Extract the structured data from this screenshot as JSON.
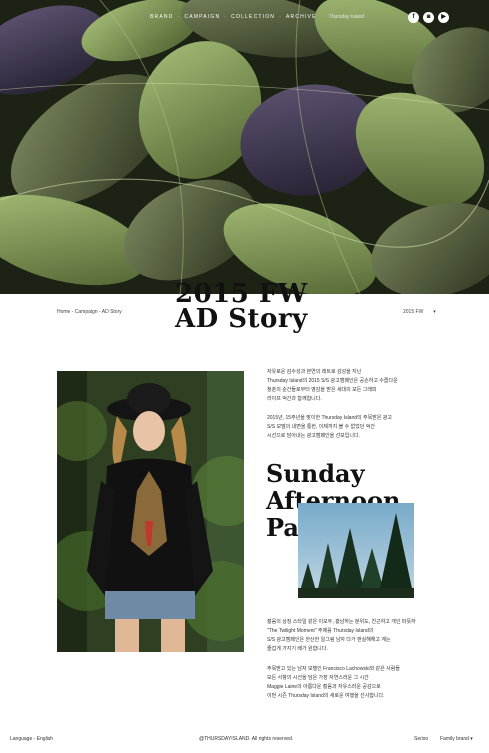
{
  "nav": {
    "items": [
      "BRAND",
      "CAMPAIGN",
      "COLLECTION",
      "ARCHIVE"
    ],
    "sub": "Thursday Island"
  },
  "social": {
    "facebook": "f",
    "instagram": "◙",
    "youtube": "▶"
  },
  "title": {
    "line1": "2015 FW",
    "line2": "AD Story"
  },
  "breadcrumb": "Home - Campaign - AD Story",
  "season": {
    "label": "2015 FW",
    "arrow": "▾"
  },
  "intro": {
    "p1_lines": [
      "자유로운 감수성과 본연의 레트로 감성을 지닌",
      "Thursday Island의 2015 S/S 광고캠페인은 공손하고 수줍다운",
      "청춘의 순간들로부터 영감을 받은 세대의 모든 그래피",
      "라이프 억간과 함께합니다."
    ],
    "p2_lines": [
      "2015년, 15주년을 맞이한 Thursday Island의 주목받은 광고",
      "S/S 모델의 내면을 통한, 이제까지 볼 수 없었던 억간",
      "시선으로 담아내는 광고캠페인을 선보입니다."
    ]
  },
  "feature": {
    "line1": "Sunday",
    "line2": "Afternoon",
    "line3": "Park"
  },
  "body": {
    "p3_lines": [
      "젊음의 상징 스타일 같은 이모두, 흥남하는 분위도, 친근하고 개인 따뜻하",
      "\"The Twilight Moment\" 주제를 Thursday Island의",
      "S/S 광고캠페인은 한산한 일그림 남자 다가 펀실해해고 계는",
      "즐겁게 가지기 배가 원합니다."
    ],
    "p4_lines": [
      "주목받고 있는 남자 모델인 Francisco Lachowski와 같은 사람들",
      "모든 사항의 시선을 담은 가장 자연스러운 그 시간",
      "Maggie Laine의 아름다운 젊음과 자유스러운 공감으로",
      "이번 시즌 Thursday Island의 새로운 여행을 선사합니다."
    ]
  },
  "footer": {
    "language": "Language - English",
    "copyright": "@THURSDAYISLAND. All rights reserved.",
    "seri": "Seriso",
    "family": "Family brand",
    "arrow": "▾"
  }
}
